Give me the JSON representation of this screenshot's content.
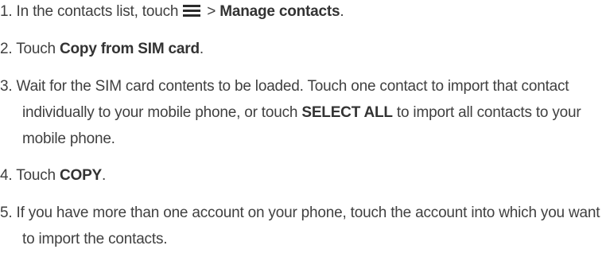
{
  "steps": [
    {
      "num": "1.",
      "text_before": "In the contacts list, touch",
      "icon": "menu-icon",
      "text_middle": "> ",
      "bold": "Manage contacts",
      "text_after": "."
    },
    {
      "num": "2.",
      "text_before": "Touch ",
      "bold": "Copy from SIM card",
      "text_after": "."
    },
    {
      "num": "3.",
      "text_before": "Wait for the SIM card contents to be loaded. Touch one contact to import that contact individually to your mobile phone, or touch ",
      "bold": "SELECT ALL",
      "text_after": " to import all contacts to your mobile phone."
    },
    {
      "num": "4.",
      "text_before": "Touch ",
      "bold": "COPY",
      "text_after": "."
    },
    {
      "num": "5.",
      "text_before": "If you have more than one account on your phone, touch the account into which you want to import the contacts."
    }
  ]
}
